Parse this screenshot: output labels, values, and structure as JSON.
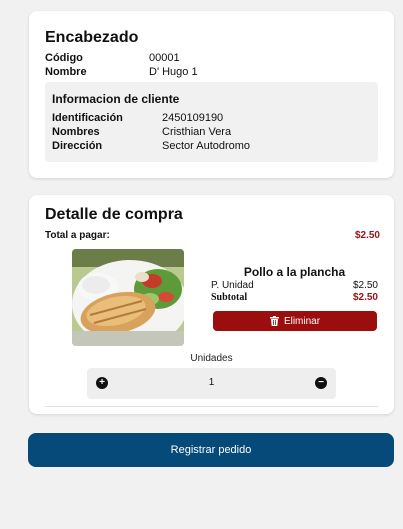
{
  "header": {
    "title": "Encabezado",
    "codigo_label": "Código",
    "codigo_value": "00001",
    "nombre_label": "Nombre",
    "nombre_value": "D' Hugo 1",
    "client": {
      "title": "Informacion de cliente",
      "id_label": "Identificación",
      "id_value": "2450109190",
      "names_label": "Nombres",
      "names_value": "Cristhian Vera",
      "address_label": "Dirección",
      "address_value": "Sector Autodromo"
    }
  },
  "detail": {
    "title": "Detalle de compra",
    "total_label": "Total a pagar:",
    "total_value": "$2.50",
    "product": {
      "name": "Pollo a la plancha",
      "unit_price_label": "P. Unidad",
      "unit_price_value": "$2.50",
      "subtotal_label": "Subtotal",
      "subtotal_value": "$2.50",
      "delete_label": "Eliminar",
      "image_alt": "Pollo a la plancha"
    },
    "units_label": "Unidades",
    "units_value": "1",
    "plus_symbol": "+",
    "minus_symbol": "−"
  },
  "register_label": "Registrar pedido",
  "colors": {
    "accent_red": "#9c0e0e",
    "primary_blue": "#064a7a"
  }
}
